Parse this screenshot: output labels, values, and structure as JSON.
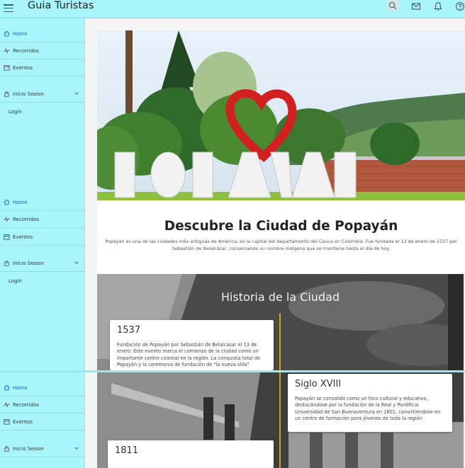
{
  "app": {
    "title": "Guia Turistas"
  },
  "sidebar": {
    "items": [
      {
        "label": "Home",
        "icon": "home-icon"
      },
      {
        "label": "Recorridos",
        "icon": "route-icon"
      },
      {
        "label": "Eventos",
        "icon": "calendar-icon"
      },
      {
        "label": "Inicio Sesion",
        "icon": "lock-icon"
      }
    ],
    "login_label": "Login"
  },
  "hero": {
    "sign_text": "POPAYÁN"
  },
  "intro": {
    "title": "Descubre la Ciudad de Popayán",
    "text": "Popayán es una de las ciudades más antiguas de América, es la capital del departamento del Cauca en Colombia. Fue fundada el 13 de enero de 1537 por Sebastián de Belalcázar, conservando su nombre indígena que se mantiene hasta el día de hoy."
  },
  "history": {
    "title": "Historia de la Ciudad",
    "events": [
      {
        "year": "1537",
        "text": "Fundación de Popayán por Sebastián de Belalcázar el 13 de enero. Este evento marca el comienzo de la ciudad como un importante centro colonial en la región. La conquista total de Popayán y la ceremonia de fundación de \"la nueva villa\""
      },
      {
        "year": "Siglo XVIII",
        "text": "Popayán se consolidó como un foco cultural y educativo, destacándose por la fundación de la Real y Pontificia Universidad de San Buenaventura en 1801, convirtiéndose en un centro de formación para jóvenes de toda la región"
      },
      {
        "year": "1811",
        "text": ""
      }
    ]
  },
  "colors": {
    "sidebar_bg": "#a8f6fb",
    "active_link": "#1565c0",
    "timeline_accent": "#d4a017"
  }
}
